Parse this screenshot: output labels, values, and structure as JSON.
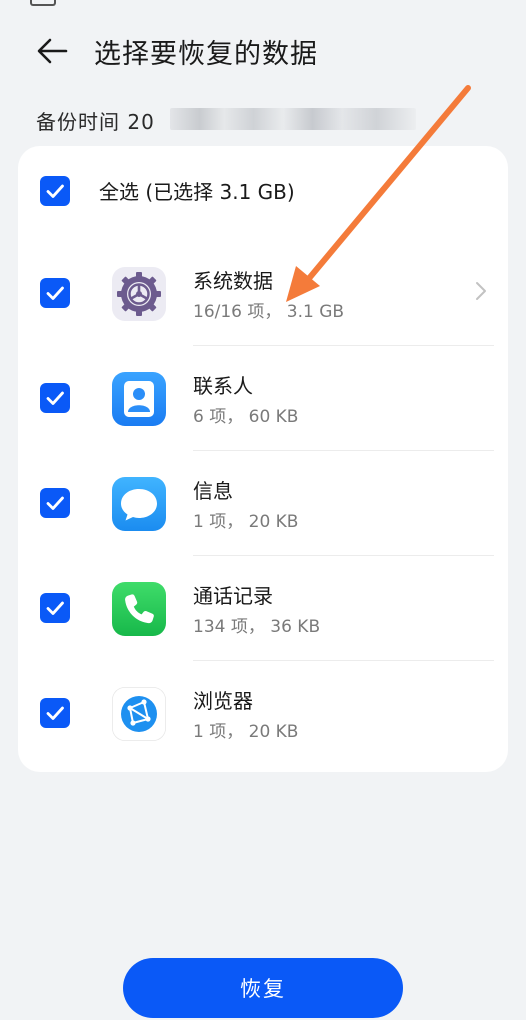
{
  "header": {
    "title": "选择要恢复的数据"
  },
  "backup": {
    "label": "备份时间 20"
  },
  "select_all": {
    "label": "全选 (已选择 3.1 GB)",
    "checked": true
  },
  "items": [
    {
      "name": "系统数据",
      "detail": "16/16 项，  3.1 GB",
      "icon": "settings-gear-icon",
      "checked": true,
      "has_chevron": true
    },
    {
      "name": "联系人",
      "detail": "6 项，  60 KB",
      "icon": "contacts-person-icon",
      "checked": true
    },
    {
      "name": "信息",
      "detail": "1 项，  20 KB",
      "icon": "message-bubble-icon",
      "checked": true
    },
    {
      "name": "通话记录",
      "detail": "134 项，  36 KB",
      "icon": "phone-handset-icon",
      "checked": true
    },
    {
      "name": "浏览器",
      "detail": "1 项，  20 KB",
      "icon": "browser-globe-icon",
      "checked": true
    }
  ],
  "restore": {
    "label": "恢复"
  },
  "colors": {
    "accent": "#0a59f7",
    "annotation_arrow": "#f47b3a",
    "background": "#f1f3f5",
    "card": "#ffffff"
  }
}
